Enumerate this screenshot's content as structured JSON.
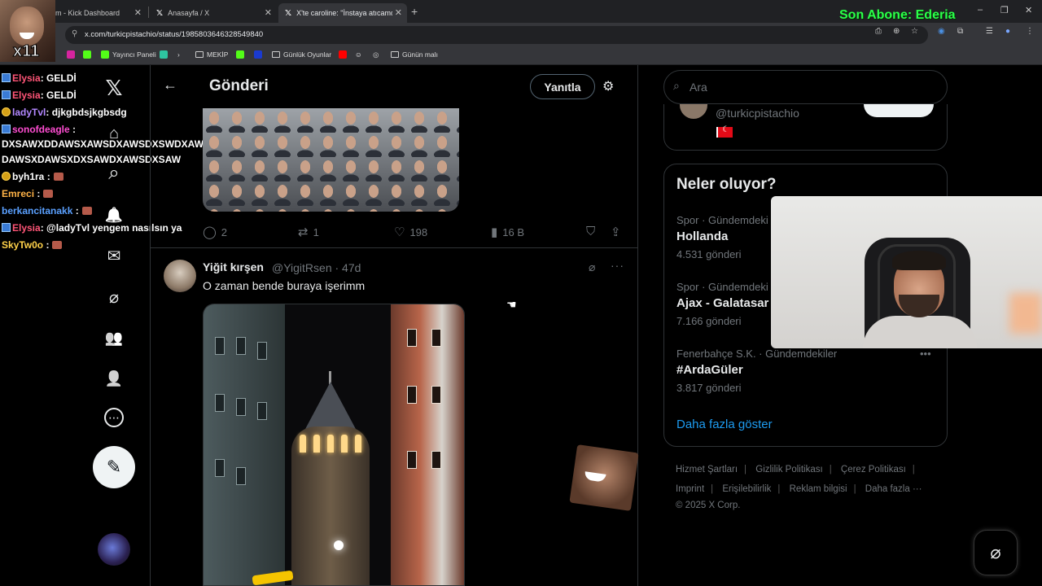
{
  "browser": {
    "tabs": [
      {
        "label": "m - Kick Dashboard"
      },
      {
        "label": "Anasayfa / X"
      },
      {
        "label": "X'te caroline: \"İnstaya atıcamdı"
      }
    ],
    "url": "x.com/turkicpistachio/status/1985803646328549840",
    "bookmarks": {
      "yayinci": "Yayıncı Paneli",
      "mekip": "MEKİP",
      "gunluk": "Günlük Oyunlar",
      "gunun": "Günün malı"
    }
  },
  "overlay": {
    "son_abone": "Son Abone: Ederia"
  },
  "chat": [
    {
      "user": "Elysia",
      "text": ": GELDİ",
      "color": "#ff5577"
    },
    {
      "user": "Elysia",
      "text": ": GELDİ",
      "color": "#ff5577"
    },
    {
      "user": "ladyTvl",
      "text": ": djkgbdsjkgbsdg",
      "color": "#b388ff"
    },
    {
      "user": "sonofdeagle",
      "text": " :",
      "color": "#ff4dd2"
    },
    {
      "user": "",
      "text": "DXSAWXDDAWSXAWSDXAWSDXSWDXAWSDXWDASX",
      "color": "#ffffff"
    },
    {
      "user": "",
      "text": "DAWSXDAWSXDXSAWDXAWSDXSAW",
      "color": "#ffffff"
    },
    {
      "user": "byh1ra",
      "text": " :",
      "color": "#ffffff"
    },
    {
      "user": "Emreci",
      "text": " :",
      "color": "#ffb347"
    },
    {
      "user": "berkancitanakk",
      "text": " :",
      "color": "#5aa0ff"
    },
    {
      "user": "Elysia",
      "text": ": @ladyTvl yengem nasılsın ya",
      "color": "#ff5577"
    },
    {
      "user": "SkyTw0o",
      "text": " :",
      "color": "#ffd24a"
    }
  ],
  "main": {
    "header_title": "Gönderi",
    "reply_label": "Yanıtla",
    "prev_post_actions": {
      "replies": "2",
      "reposts": "1",
      "likes": "198",
      "views": "16 B"
    },
    "post": {
      "name": "Yiğit kırşen",
      "handle": "@YigitRsen · 47d",
      "text": "O zaman bende buraya işerimm"
    }
  },
  "right": {
    "search_placeholder": "Ara",
    "profile_handle": "@turkicpistachio",
    "trends_title": "Neler oluyor?",
    "trends": [
      {
        "category": "Spor · Gündemdeki",
        "name": "Hollanda",
        "count": "4.531 gönderi"
      },
      {
        "category": "Spor · Gündemdeki",
        "name": "Ajax - Galatasar",
        "count": "7.166 gönderi"
      },
      {
        "category": "Fenerbahçe S.K. · Gündemdekiler",
        "name": "#ArdaGüler",
        "count": "3.817 gönderi"
      }
    ],
    "show_more": "Daha fazla göster",
    "footer": {
      "terms": "Hizmet Şartları",
      "privacy": "Gizlilik Politikası",
      "cookies": "Çerez Politikası",
      "imprint": "Imprint",
      "accessibility": "Erişilebilirlik",
      "ads": "Reklam bilgisi",
      "more": "Daha fazla ···",
      "copyright": "© 2025 X Corp."
    }
  },
  "icons": {
    "x_logo": "𝕏",
    "home": "⌂",
    "search": "⌕",
    "bell": "🔔",
    "mail": "✉",
    "grok": "⌀",
    "people": "👥",
    "profile": "👤",
    "more": "⋯"
  }
}
